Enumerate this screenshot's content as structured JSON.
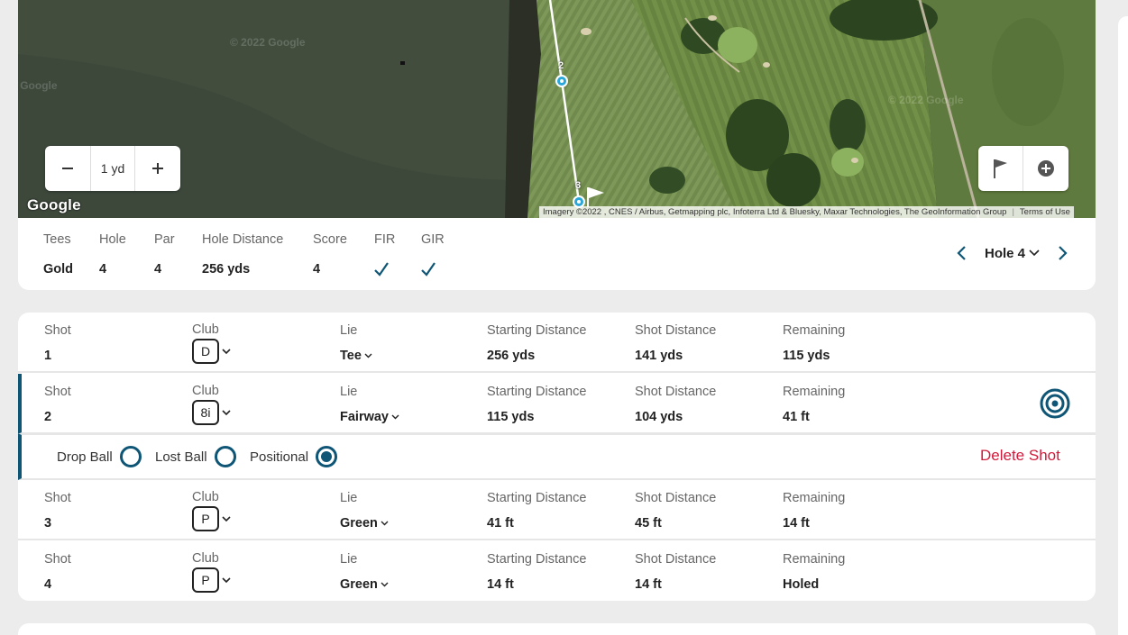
{
  "map": {
    "zoom_out_icon": "minus-icon",
    "zoom_value": "1 yd",
    "zoom_in_icon": "plus-icon",
    "flag_tool_icon": "flag-icon",
    "add_tool_icon": "plus-circle-icon",
    "google_logo": "Google",
    "attribution": "Imagery ©2022 , CNES / Airbus, Getmapping plc, Infoterra Ltd & Bluesky, Maxar Technologies, The GeoInformation Group",
    "terms": "Terms of Use",
    "watermarks": [
      "© 2022 Google",
      "© 2022 Google",
      "© 2022 Google"
    ],
    "shot_markers": [
      "2",
      "3"
    ]
  },
  "hole_info": {
    "columns": [
      {
        "label": "Tees",
        "value": "Gold"
      },
      {
        "label": "Hole",
        "value": "4"
      },
      {
        "label": "Par",
        "value": "4"
      },
      {
        "label": "Hole Distance",
        "value": "256 yds"
      },
      {
        "label": "Score",
        "value": "4"
      },
      {
        "label": "FIR",
        "value": "check-icon"
      },
      {
        "label": "GIR",
        "value": "check-icon"
      }
    ],
    "nav": {
      "prev_icon": "chevron-left-icon",
      "label": "Hole 4",
      "next_icon": "chevron-right-icon"
    }
  },
  "shots": {
    "headers": {
      "shot": "Shot",
      "club": "Club",
      "lie": "Lie",
      "starting": "Starting Distance",
      "shot_distance": "Shot Distance",
      "remaining": "Remaining"
    },
    "rows": [
      {
        "shot": "1",
        "club": "D",
        "lie": "Tee",
        "starting": "256 yds",
        "shot_distance": "141 yds",
        "remaining": "115 yds"
      },
      {
        "shot": "2",
        "club": "8i",
        "lie": "Fairway",
        "starting": "115 yds",
        "shot_distance": "104 yds",
        "remaining": "41 ft"
      },
      {
        "shot": "3",
        "club": "P",
        "lie": "Green",
        "starting": "41 ft",
        "shot_distance": "45 ft",
        "remaining": "14 ft"
      },
      {
        "shot": "4",
        "club": "P",
        "lie": "Green",
        "starting": "14 ft",
        "shot_distance": "14 ft",
        "remaining": "Holed"
      }
    ],
    "active_options": {
      "drop_ball": "Drop Ball",
      "lost_ball": "Lost Ball",
      "positional": "Positional",
      "selected": "Positional",
      "delete": "Delete Shot"
    }
  },
  "colors": {
    "accent": "#0f5676",
    "danger": "#d11a3c",
    "marker": "#2aa7d8"
  }
}
